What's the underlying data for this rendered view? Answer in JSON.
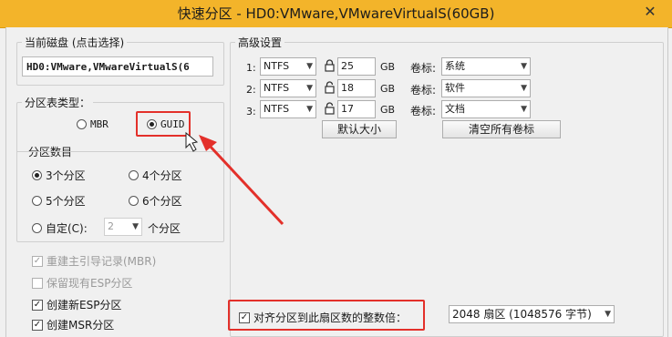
{
  "window": {
    "title": "快速分区 - HD0:VMware,VMwareVirtualS(60GB)",
    "close_glyph": "✕"
  },
  "current_disk": {
    "label": "当前磁盘 (点击选择)",
    "value": "HD0:VMware,VMwareVirtualS(6"
  },
  "partition_table": {
    "label": "分区表类型：",
    "options": [
      {
        "label": "MBR",
        "selected": false
      },
      {
        "label": "GUID",
        "selected": true
      }
    ]
  },
  "partition_count": {
    "label": "分区数目",
    "options": [
      {
        "label": "3个分区",
        "selected": true
      },
      {
        "label": "4个分区",
        "selected": false
      },
      {
        "label": "5个分区",
        "selected": false
      },
      {
        "label": "6个分区",
        "selected": false
      }
    ],
    "custom_label": "自定(C):",
    "custom_value": "2",
    "custom_suffix": "个分区"
  },
  "options": [
    {
      "label": "重建主引导记录(MBR)",
      "checked": true,
      "disabled": true
    },
    {
      "label": "保留现有ESP分区",
      "checked": false,
      "disabled": true
    },
    {
      "label": "创建新ESP分区",
      "checked": true,
      "disabled": false
    },
    {
      "label": "创建MSR分区",
      "checked": true,
      "disabled": false
    }
  ],
  "advanced": {
    "label": "高级设置",
    "rows": [
      {
        "index": "1:",
        "fs": "NTFS",
        "size": "25",
        "unit": "GB",
        "vol_label_text": "卷标:",
        "vol": "系统"
      },
      {
        "index": "2:",
        "fs": "NTFS",
        "size": "18",
        "unit": "GB",
        "vol_label_text": "卷标:",
        "vol": "软件"
      },
      {
        "index": "3:",
        "fs": "NTFS",
        "size": "17",
        "unit": "GB",
        "vol_label_text": "卷标:",
        "vol": "文档"
      }
    ],
    "default_size_button": "默认大小",
    "clear_labels_button": "清空所有卷标"
  },
  "align": {
    "label": "对齐分区到此扇区数的整数倍：",
    "checked": true,
    "value": "2048 扇区 (1048576 字节)"
  },
  "colors": {
    "titlebar": "#f3b42a",
    "highlight": "#e3302a"
  }
}
